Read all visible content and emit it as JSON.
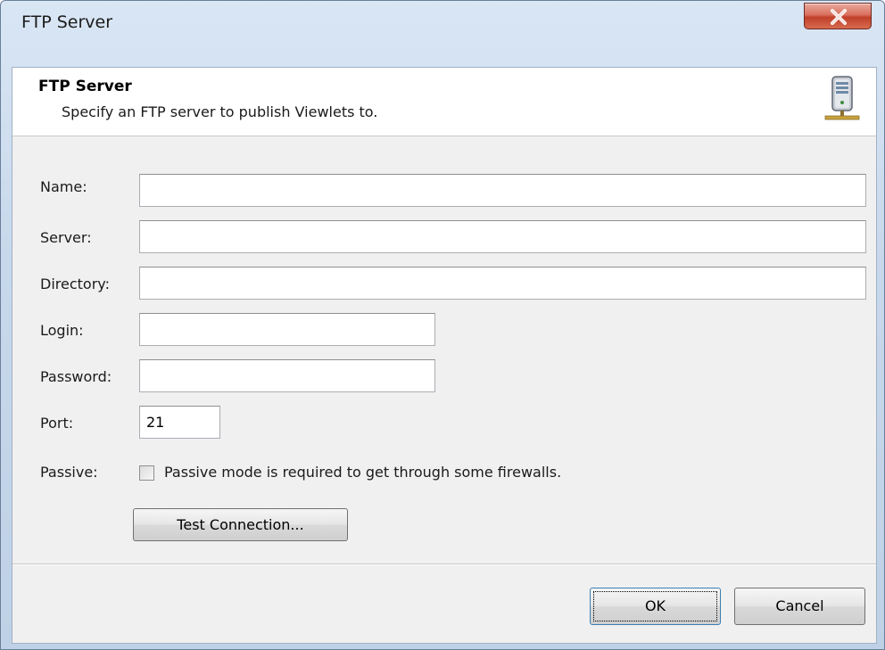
{
  "window": {
    "title": "FTP Server",
    "close_icon": "close-icon"
  },
  "banner": {
    "title": "FTP Server",
    "subtitle": "Specify an FTP server to publish Viewlets to.",
    "icon": "server-icon"
  },
  "form": {
    "name_label": "Name:",
    "name_value": "",
    "server_label": "Server:",
    "server_value": "",
    "directory_label": "Directory:",
    "directory_value": "",
    "login_label": "Login:",
    "login_value": "",
    "password_label": "Password:",
    "password_value": "",
    "port_label": "Port:",
    "port_value": "21",
    "passive_label": "Passive:",
    "passive_checked": false,
    "passive_text": "Passive mode is required to get through some firewalls.",
    "test_button": "Test Connection..."
  },
  "footer": {
    "ok_label": "OK",
    "cancel_label": "Cancel"
  }
}
